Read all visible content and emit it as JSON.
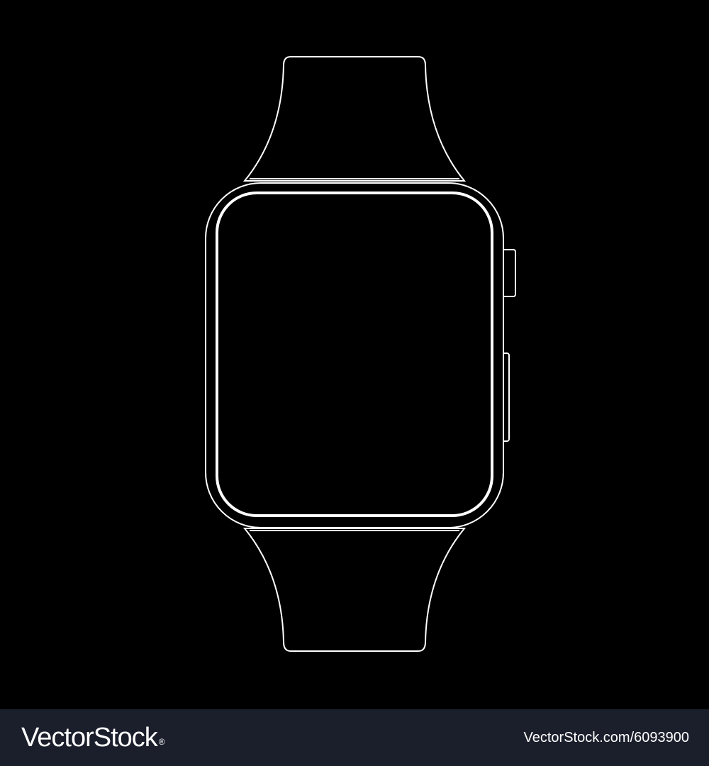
{
  "illustration": {
    "subject": "smartwatch-outline-icon",
    "background_color": "#000000",
    "outline_color": "#ffffff"
  },
  "footer": {
    "brand": "VectorStock",
    "brand_mark": "®",
    "image_id": "VectorStock.com/6093900",
    "background_color": "#1b1f2b"
  }
}
